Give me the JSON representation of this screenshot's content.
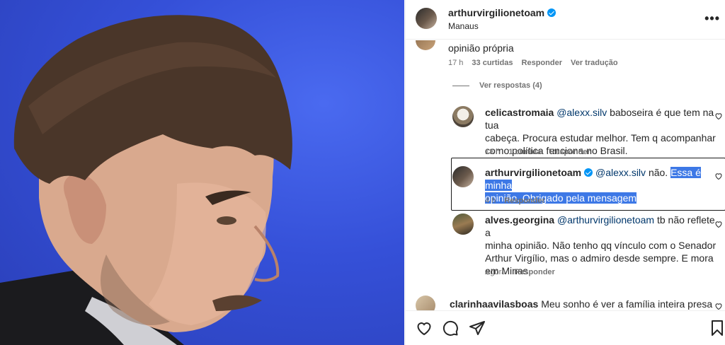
{
  "post": {
    "username": "arthurvirgilionetoam",
    "location": "Manaus",
    "more_label": "•••"
  },
  "top_comment": {
    "text": "opinião própria",
    "time": "17 h",
    "likes": "33 curtidas",
    "reply": "Responder",
    "translate": "Ver tradução"
  },
  "view_replies": "Ver respostas (4)",
  "replies": [
    {
      "username": "celicastromaia",
      "mention": "@alexx.silv",
      "lines": [
        "baboseira é que tem na tua",
        "cabeça. Procura estudar melhor. Tem q acompanhar",
        "como política funciona no Brasil."
      ],
      "time": "13 h",
      "likes": "1 curtida",
      "reply": "Responder"
    },
    {
      "username": "arthurvirgilionetoam",
      "mention": "@alexx.silv",
      "pre_selection": "não.",
      "selected_line1": "Essa é minha",
      "selected_line2": "opinião. Obrigado pela mensagem",
      "time": "4 h",
      "reply": "Responder"
    },
    {
      "username": "alves.georgina",
      "mention": "@arthurvirgilionetoam",
      "lines": [
        "tb não reflete a",
        "minha opinião. Não tenho qq vínculo com o Senador",
        "Arthur Virgílio, mas o admiro desde sempre. E mora",
        "em Minas"
      ],
      "time": "Agora",
      "reply": "Responder"
    }
  ],
  "next_comment": {
    "username": "clarinhaavilasboas",
    "text": "Meu sonho é ver a família inteira presa"
  },
  "icons": {
    "like": "heart-icon",
    "comment": "comment-icon",
    "share": "send-icon",
    "save": "bookmark-icon"
  },
  "colors": {
    "photo_background": "#3550d8",
    "selection": "#3d78e6",
    "mention": "#00376b",
    "verified": "#0095f6"
  }
}
